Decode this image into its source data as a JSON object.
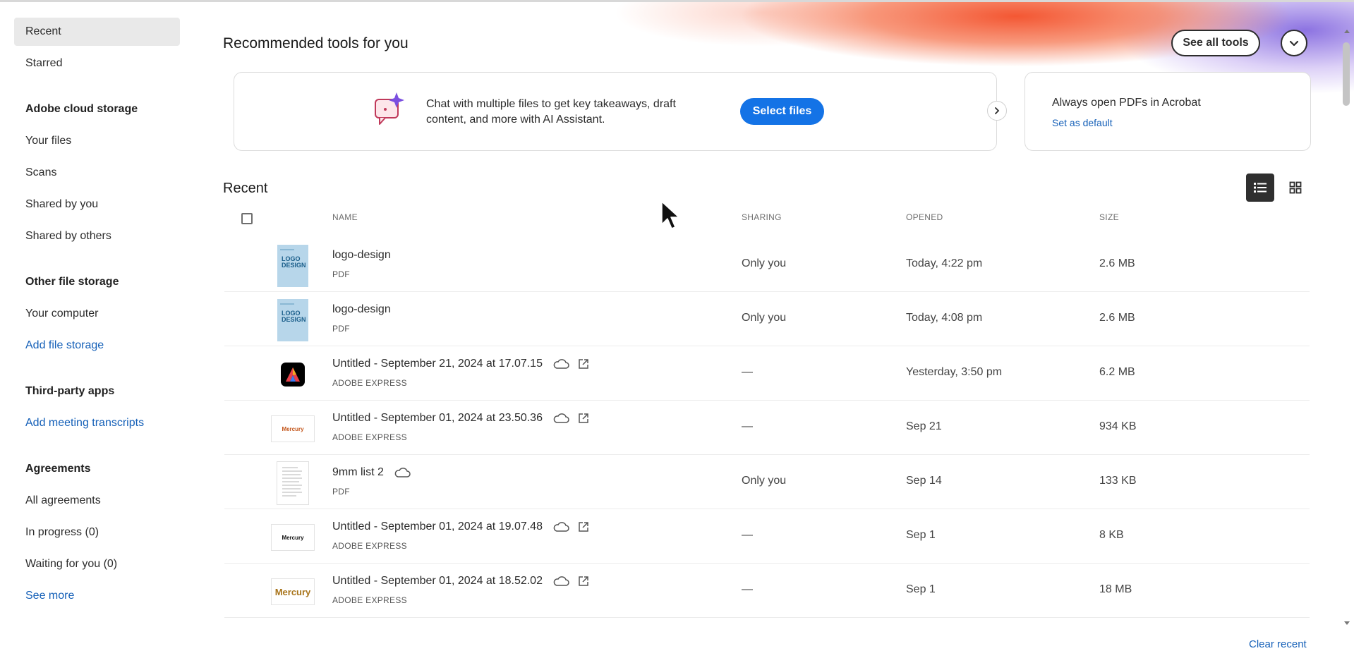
{
  "sidebar": {
    "recent": "Recent",
    "starred": "Starred",
    "cloud_heading": "Adobe cloud storage",
    "your_files": "Your files",
    "scans": "Scans",
    "shared_by_you": "Shared by you",
    "shared_by_others": "Shared by others",
    "other_heading": "Other file storage",
    "your_computer": "Your computer",
    "add_file_storage": "Add file storage",
    "third_party_heading": "Third-party apps",
    "add_meeting_transcripts": "Add meeting transcripts",
    "agreements_heading": "Agreements",
    "all_agreements": "All agreements",
    "in_progress": "In progress (0)",
    "waiting_for_you": "Waiting for you (0)",
    "see_more": "See more"
  },
  "tools": {
    "title": "Recommended tools for you",
    "see_all": "See all tools",
    "ai_card_text_line1": "Chat with multiple files to get key takeaways, draft",
    "ai_card_text_line2": "content, and more with AI Assistant.",
    "select_files": "Select files",
    "default_card_text": "Always open PDFs in Acrobat",
    "set_as_default": "Set as default"
  },
  "recent": {
    "title": "Recent",
    "clear_recent": "Clear recent",
    "columns": {
      "name": "NAME",
      "sharing": "SHARING",
      "opened": "OPENED",
      "size": "SIZE"
    },
    "rows": [
      {
        "name": "logo-design",
        "type": "PDF",
        "sharing": "Only you",
        "opened": "Today, 4:22 pm",
        "size": "2.6 MB",
        "thumb": "logo-pdf",
        "thumb_text": "LOGO DESIGN"
      },
      {
        "name": "logo-design",
        "type": "PDF",
        "sharing": "Only you",
        "opened": "Today, 4:08 pm",
        "size": "2.6 MB",
        "thumb": "logo-pdf",
        "thumb_text": "LOGO DESIGN"
      },
      {
        "name": "Untitled - September 21, 2024 at 17.07.15",
        "type": "ADOBE EXPRESS",
        "sharing": "—",
        "opened": "Yesterday, 3:50 pm",
        "size": "6.2 MB",
        "thumb": "express-logo"
      },
      {
        "name": "Untitled - September 01, 2024 at 23.50.36",
        "type": "ADOBE EXPRESS",
        "sharing": "—",
        "opened": "Sep 21",
        "size": "934 KB",
        "thumb": "mercury-orange",
        "thumb_text": "Mercury"
      },
      {
        "name": "9mm list 2",
        "type": "PDF",
        "sharing": "Only you",
        "opened": "Sep 14",
        "size": "133 KB",
        "thumb": "doc-page"
      },
      {
        "name": "Untitled - September 01, 2024 at 19.07.48",
        "type": "ADOBE EXPRESS",
        "sharing": "—",
        "opened": "Sep 1",
        "size": "8 KB",
        "thumb": "mercury-black",
        "thumb_text": "Mercury"
      },
      {
        "name": "Untitled - September 01, 2024 at 18.52.02",
        "type": "ADOBE EXPRESS",
        "sharing": "—",
        "opened": "Sep 1",
        "size": "18 MB",
        "thumb": "mercury-gold",
        "thumb_text": "Mercury"
      }
    ]
  },
  "colors": {
    "accent": "#1473e6",
    "link": "#1560b8",
    "banner_orange": "#f34e28",
    "banner_purple": "#7a5ade"
  }
}
